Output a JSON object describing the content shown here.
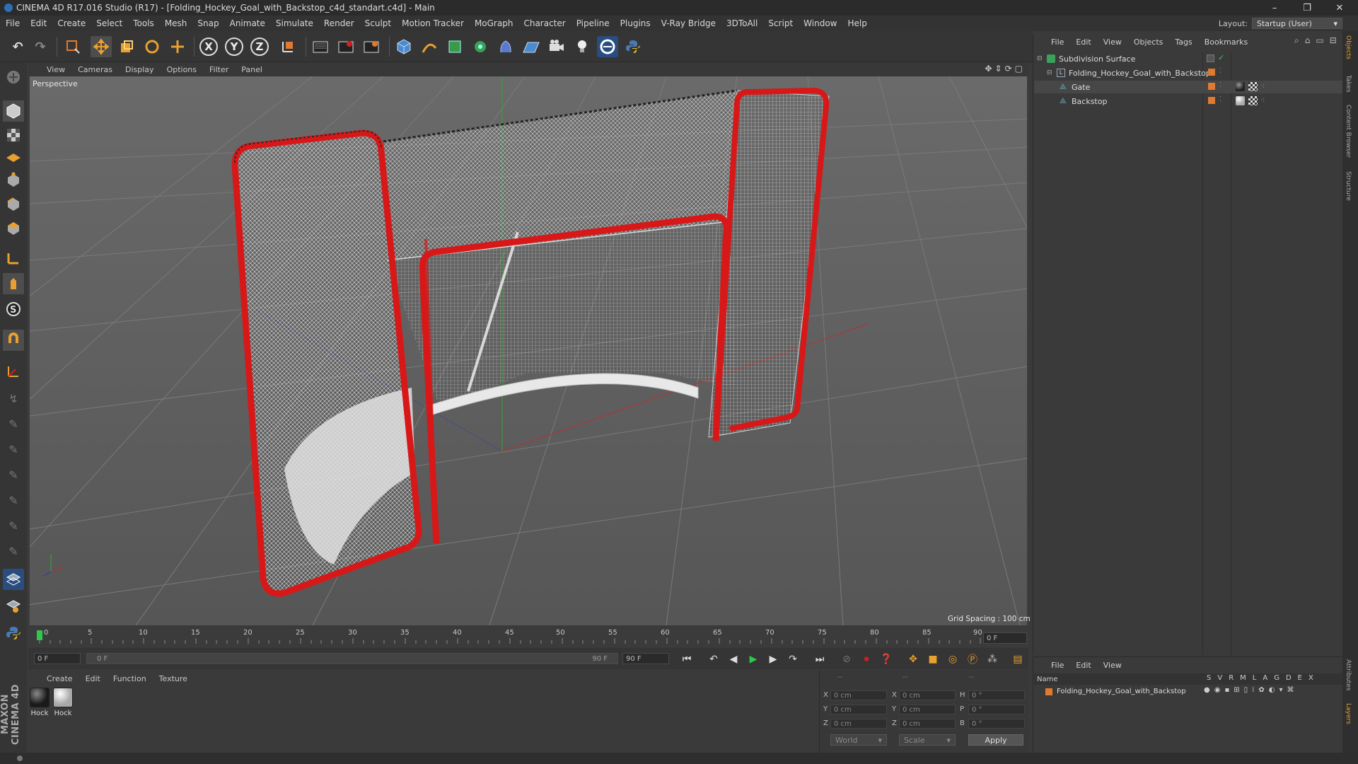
{
  "window": {
    "title": "CINEMA 4D R17.016 Studio (R17) - [Folding_Hockey_Goal_with_Backstop_c4d_standart.c4d] - Main",
    "controls": [
      "–",
      "❐",
      "✕"
    ]
  },
  "menubar": {
    "items": [
      "File",
      "Edit",
      "Create",
      "Select",
      "Tools",
      "Mesh",
      "Snap",
      "Animate",
      "Simulate",
      "Render",
      "Sculpt",
      "Motion Tracker",
      "MoGraph",
      "Character",
      "Pipeline",
      "Plugins",
      "V-Ray Bridge",
      "3DToAll",
      "Script",
      "Window",
      "Help"
    ],
    "layout_label": "Layout:",
    "layout_value": "Startup (User)"
  },
  "viewport": {
    "menu": [
      "View",
      "Cameras",
      "Display",
      "Options",
      "Filter",
      "Panel"
    ],
    "camera_label": "Perspective",
    "grid_spacing": "Grid Spacing : 100 cm"
  },
  "timeline": {
    "ticks": [
      "0",
      "5",
      "10",
      "15",
      "20",
      "25",
      "30",
      "35",
      "40",
      "45",
      "50",
      "55",
      "60",
      "65",
      "70",
      "75",
      "80",
      "85",
      "90"
    ],
    "current_frame": "0 F"
  },
  "playbar": {
    "start_field": "0 F",
    "range_start": "0 F",
    "range_end": "90 F",
    "end_field": "90 F"
  },
  "materials": {
    "menu": [
      "Create",
      "Edit",
      "Function",
      "Texture"
    ],
    "items": [
      {
        "label": "Hock",
        "color": "#1a1a1a"
      },
      {
        "label": "Hock",
        "color": "#c8c8c8"
      }
    ],
    "brand": "MAXON CINEMA 4D"
  },
  "coordinates": {
    "header": [
      "--",
      "--",
      "--"
    ],
    "rows": [
      {
        "axis": "X",
        "pos": "0 cm",
        "axis2": "X",
        "size": "0 cm",
        "axis3": "H",
        "rot": "0 °"
      },
      {
        "axis": "Y",
        "pos": "0 cm",
        "axis2": "Y",
        "size": "0 cm",
        "axis3": "P",
        "rot": "0 °"
      },
      {
        "axis": "Z",
        "pos": "0 cm",
        "axis2": "Z",
        "size": "0 cm",
        "axis3": "B",
        "rot": "0 °"
      }
    ],
    "mode_world": "World",
    "mode_scale": "Scale",
    "apply_label": "Apply"
  },
  "objects": {
    "menu": [
      "File",
      "Edit",
      "View",
      "Objects",
      "Tags",
      "Bookmarks"
    ],
    "tree": [
      {
        "name": "Subdivision Surface",
        "depth": 0
      },
      {
        "name": "Folding_Hockey_Goal_with_Backstop",
        "depth": 1
      },
      {
        "name": "Gate",
        "depth": 2
      },
      {
        "name": "Backstop",
        "depth": 2
      }
    ]
  },
  "layers": {
    "menu": [
      "File",
      "Edit",
      "View"
    ],
    "header_name": "Name",
    "header_cols": [
      "S",
      "V",
      "R",
      "M",
      "L",
      "A",
      "G",
      "D",
      "E",
      "X"
    ],
    "row_name": "Folding_Hockey_Goal_with_Backstop"
  },
  "right_tabs": [
    "Objects",
    "Takes",
    "Content Browser",
    "Structure"
  ],
  "right_tabs_lower": [
    "Attributes",
    "Layers"
  ],
  "colors": {
    "accent_orange": "#e07a2e",
    "frame_red": "#d01818",
    "selection_blue": "#2e6ab0",
    "timeline_marker_green": "#2ec84a"
  }
}
